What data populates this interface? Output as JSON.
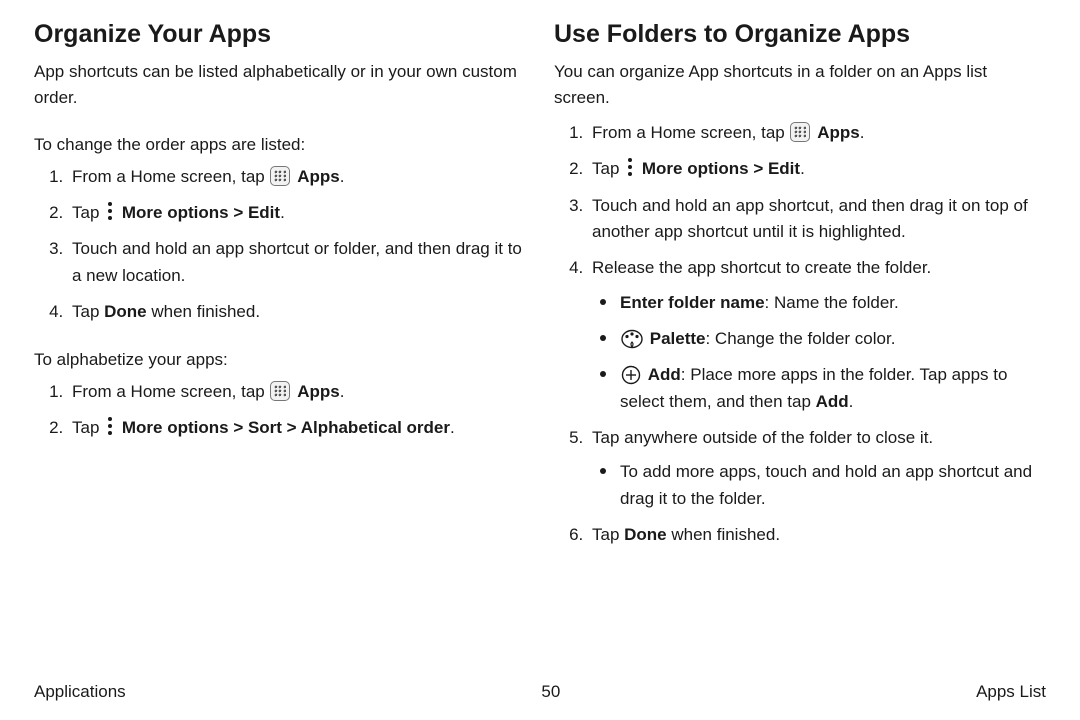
{
  "left": {
    "heading": "Organize Your Apps",
    "lead": "App shortcuts can be listed alphabetically or in your own custom order.",
    "sub1": "To change the order apps are listed:",
    "steps1": {
      "s1a": "From a Home screen, tap ",
      "s1b": "Apps",
      "s1c": ".",
      "s2a": "Tap ",
      "s2b": "More options > Edit",
      "s2c": ".",
      "s3": "Touch and hold an app shortcut or folder, and then drag it to a new location.",
      "s4a": "Tap ",
      "s4b": "Done",
      "s4c": " when finished."
    },
    "sub2": "To alphabetize your apps:",
    "steps2": {
      "s1a": "From a Home screen, tap ",
      "s1b": "Apps",
      "s1c": ".",
      "s2a": "Tap ",
      "s2b": "More options > Sort > Alphabetical order",
      "s2c": "."
    }
  },
  "right": {
    "heading": "Use Folders to Organize Apps",
    "lead": "You can organize App shortcuts in a folder on an Apps list screen.",
    "steps": {
      "s1a": "From a Home screen, tap ",
      "s1b": "Apps",
      "s1c": ".",
      "s2a": "Tap ",
      "s2b": "More options > Edit",
      "s2c": ".",
      "s3": "Touch and hold an app shortcut, and then drag it on top of another app shortcut until it is highlighted.",
      "s4": "Release the app shortcut to create the folder.",
      "b1a": "Enter folder name",
      "b1b": ": Name the folder.",
      "b2a": "Palette",
      "b2b": ": Change the folder color.",
      "b3a": "Add",
      "b3b": ": Place more apps in the folder. Tap apps to select them, and then tap ",
      "b3c": "Add",
      "b3d": ".",
      "s5": "Tap anywhere outside of the folder to close it.",
      "b5": "To add more apps, touch and hold an app shortcut and drag it to the folder.",
      "s6a": "Tap ",
      "s6b": "Done",
      "s6c": " when finished."
    }
  },
  "footer": {
    "left": "Applications",
    "center": "50",
    "right": "Apps List"
  }
}
